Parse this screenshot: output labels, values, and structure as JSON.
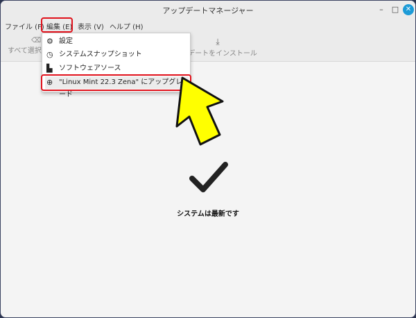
{
  "window": {
    "title": "アップデートマネージャー",
    "minimize": "–",
    "maximize": "□",
    "close": "✕"
  },
  "menubar": [
    {
      "label": "ファイル (F)"
    },
    {
      "label": "編集 (E)"
    },
    {
      "label": "表示 (V)"
    },
    {
      "label": "ヘルプ (H)"
    }
  ],
  "toolbar": {
    "select_all": "すべて選択",
    "install": "アップデートをインストール"
  },
  "edit_menu": [
    {
      "label": "設定",
      "icon": "preferences-icon"
    },
    {
      "label": "システムスナップショット",
      "icon": "clock-icon"
    },
    {
      "label": "ソフトウェアソース",
      "icon": "package-icon"
    },
    {
      "label": "\"Linux Mint 22.3 Zena\" にアップグレード",
      "icon": "upgrade-arrow-icon"
    }
  ],
  "status": {
    "message": "システムは最新です"
  },
  "colors": {
    "highlight": "#e0101a",
    "pointer_arrow": "#ffff00",
    "close_button": "#1d9bd7"
  }
}
